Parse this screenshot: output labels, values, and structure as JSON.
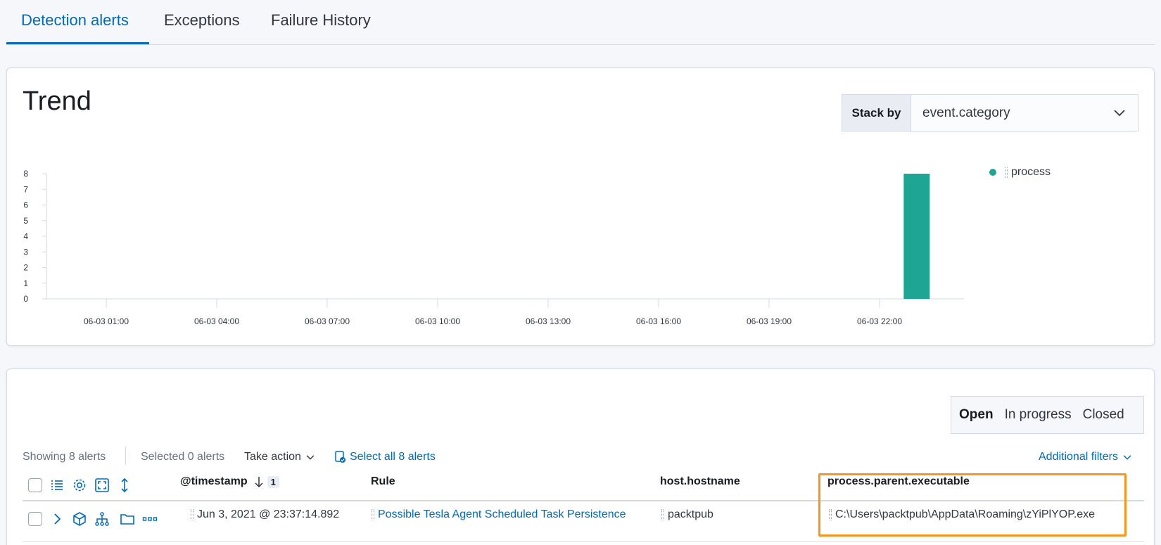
{
  "tabs": [
    {
      "label": "Detection alerts"
    },
    {
      "label": "Exceptions"
    },
    {
      "label": "Failure History"
    }
  ],
  "trend": {
    "title": "Trend",
    "stack_by_label": "Stack by",
    "stack_by_value": "event.category"
  },
  "chart_data": {
    "type": "bar",
    "x_ticks": [
      "06-03 01:00",
      "06-03 04:00",
      "06-03 07:00",
      "06-03 10:00",
      "06-03 13:00",
      "06-03 16:00",
      "06-03 19:00",
      "06-03 22:00"
    ],
    "y_ticks": [
      0,
      1,
      2,
      3,
      4,
      5,
      6,
      7,
      8
    ],
    "ylim": [
      0,
      8
    ],
    "series": [
      {
        "name": "process",
        "color": "#1ea593",
        "points": [
          {
            "x": "06-03 23:00",
            "y": 8
          }
        ]
      }
    ],
    "legend_position": "top-right"
  },
  "status_filter": {
    "open": "Open",
    "in_progress": "In progress",
    "closed": "Closed"
  },
  "utility": {
    "showing": "Showing 8 alerts",
    "selected": "Selected 0 alerts",
    "take_action": "Take action",
    "select_all": "Select all 8 alerts",
    "additional_filters": "Additional filters"
  },
  "columns": {
    "timestamp": "@timestamp",
    "sort_count": "1",
    "rule": "Rule",
    "host": "host.hostname",
    "parent_exe": "process.parent.executable"
  },
  "rows": [
    {
      "timestamp": "Jun 3, 2021 @ 23:37:14.892",
      "rule": "Possible Tesla Agent Scheduled Task Persistence",
      "host": "packtpub",
      "parent_exe": "C:\\Users\\packtpub\\AppData\\Roaming\\zYiPlYOP.exe"
    }
  ],
  "colors": {
    "accent": "#006bb8",
    "bar": "#1ea593",
    "highlight": "#f7941d"
  },
  "icons": [
    "chevron-down-icon",
    "list-icon",
    "gear-icon",
    "fullscreen-icon",
    "sort-icon",
    "expand-icon",
    "cube-icon",
    "hierarchy-icon",
    "folder-icon",
    "more-icon",
    "select-all-icon"
  ]
}
